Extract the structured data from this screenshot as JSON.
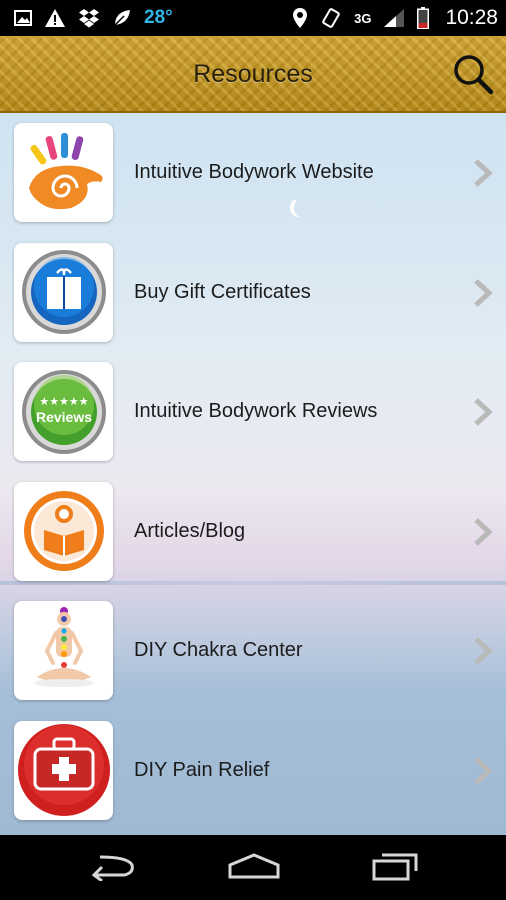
{
  "status_bar": {
    "temperature": "28°",
    "network": "3G",
    "time": "10:28",
    "icons": [
      "image-icon",
      "warning-icon",
      "dropbox-icon",
      "leaf-icon",
      "location-icon",
      "vibrate-icon",
      "signal-icon",
      "battery-icon"
    ]
  },
  "header": {
    "title": "Resources",
    "search_icon": "search-icon",
    "bar_color": "#c89a1e"
  },
  "resources": [
    {
      "label": "Intuitive Bodywork Website",
      "icon": "hand-spiral-icon"
    },
    {
      "label": "Buy Gift Certificates",
      "icon": "gift-book-icon"
    },
    {
      "label": "Intuitive Bodywork Reviews",
      "icon": "reviews-badge-icon",
      "badge_text": "Reviews"
    },
    {
      "label": "Articles/Blog",
      "icon": "reading-person-icon"
    },
    {
      "label": "DIY Chakra Center",
      "icon": "meditating-figure-icon"
    },
    {
      "label": "DIY Pain Relief",
      "icon": "first-aid-kit-icon"
    }
  ],
  "nav_bar": {
    "icons": [
      "back-icon",
      "home-icon",
      "recent-apps-icon"
    ]
  }
}
